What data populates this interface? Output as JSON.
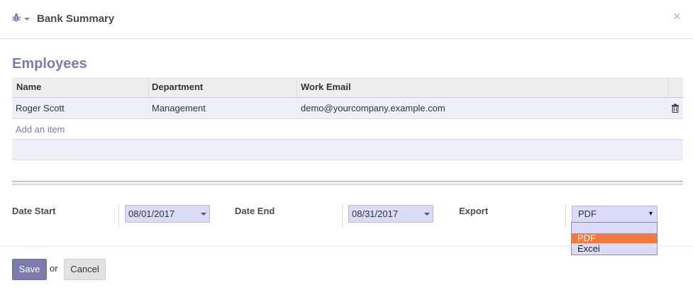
{
  "dialog": {
    "title": "Bank Summary",
    "close_glyph": "×",
    "debug_icon": "bug-icon"
  },
  "section": {
    "title": "Employees"
  },
  "table": {
    "columns": [
      "Name",
      "Department",
      "Work Email"
    ],
    "rows": [
      {
        "name": "Roger Scott",
        "department": "Management",
        "email": "demo@yourcompany.example.com"
      }
    ],
    "add_item_label": "Add an item"
  },
  "form": {
    "date_start": {
      "label": "Date Start",
      "value": "08/01/2017"
    },
    "date_end": {
      "label": "Date End",
      "value": "08/31/2017"
    },
    "export": {
      "label": "Export",
      "selected": "PDF",
      "caret": "▾",
      "options": [
        "",
        "PDF",
        "Excel"
      ]
    }
  },
  "footer": {
    "save_label": "Save",
    "or_text": "or",
    "cancel_label": "Cancel"
  },
  "colors": {
    "accent": "#7c7bad",
    "input_bg": "#dadbf7",
    "highlight": "#f07a40"
  }
}
